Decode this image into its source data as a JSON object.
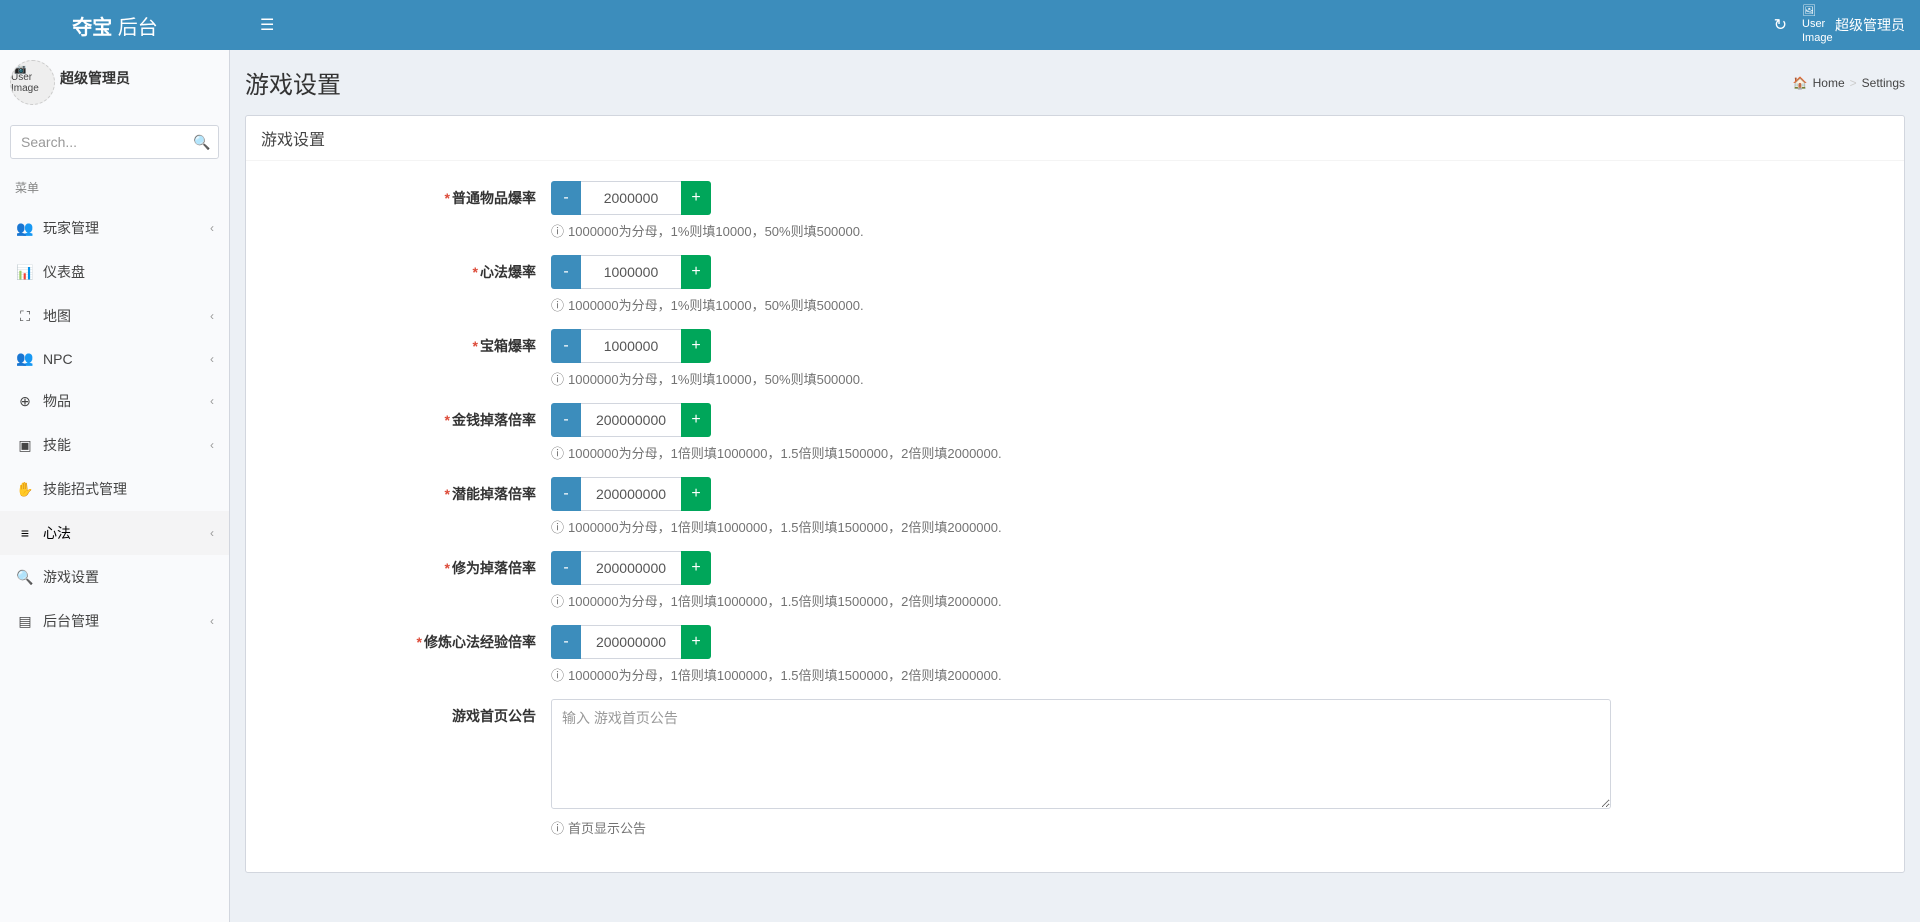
{
  "brand": {
    "bold": "夺宝",
    "light": " 后台"
  },
  "header": {
    "user_image_alt": "User Image",
    "username": "超级管理员"
  },
  "sidebar": {
    "user_image_alt": "User Image",
    "username": "超级管理员",
    "search_placeholder": "Search...",
    "menu_header": "菜单",
    "items": [
      {
        "icon": "👥",
        "label": "玩家管理",
        "has_children": true
      },
      {
        "icon": "📊",
        "label": "仪表盘",
        "has_children": false
      },
      {
        "icon": "⛶",
        "label": "地图",
        "has_children": true
      },
      {
        "icon": "👥",
        "label": "NPC",
        "has_children": true
      },
      {
        "icon": "⊕",
        "label": "物品",
        "has_children": true
      },
      {
        "icon": "▣",
        "label": "技能",
        "has_children": true
      },
      {
        "icon": "✋",
        "label": "技能招式管理",
        "has_children": false
      },
      {
        "icon": "≡",
        "label": "心法",
        "has_children": true
      },
      {
        "icon": "🔍",
        "label": "游戏设置",
        "has_children": false
      },
      {
        "icon": "▤",
        "label": "后台管理",
        "has_children": true
      }
    ]
  },
  "page": {
    "title": "游戏设置",
    "breadcrumb_home": "Home",
    "breadcrumb_current": "Settings",
    "box_title": "游戏设置"
  },
  "form": {
    "minus": "-",
    "plus": "+",
    "fields": [
      {
        "label": "普通物品爆率",
        "value": "2000000",
        "help": "1000000为分母，1%则填10000，50%则填500000."
      },
      {
        "label": "心法爆率",
        "value": "1000000",
        "help": "1000000为分母，1%则填10000，50%则填500000."
      },
      {
        "label": "宝箱爆率",
        "value": "1000000",
        "help": "1000000为分母，1%则填10000，50%则填500000."
      },
      {
        "label": "金钱掉落倍率",
        "value": "200000000",
        "help": "1000000为分母，1倍则填1000000，1.5倍则填1500000，2倍则填2000000."
      },
      {
        "label": "潜能掉落倍率",
        "value": "200000000",
        "help": "1000000为分母，1倍则填1000000，1.5倍则填1500000，2倍则填2000000."
      },
      {
        "label": "修为掉落倍率",
        "value": "200000000",
        "help": "1000000为分母，1倍则填1000000，1.5倍则填1500000，2倍则填2000000."
      },
      {
        "label": "修炼心法经验倍率",
        "value": "200000000",
        "help": "1000000为分母，1倍则填1000000，1.5倍则填1500000，2倍则填2000000."
      }
    ],
    "announcement": {
      "label": "游戏首页公告",
      "placeholder": "输入 游戏首页公告",
      "help": "首页显示公告"
    }
  }
}
